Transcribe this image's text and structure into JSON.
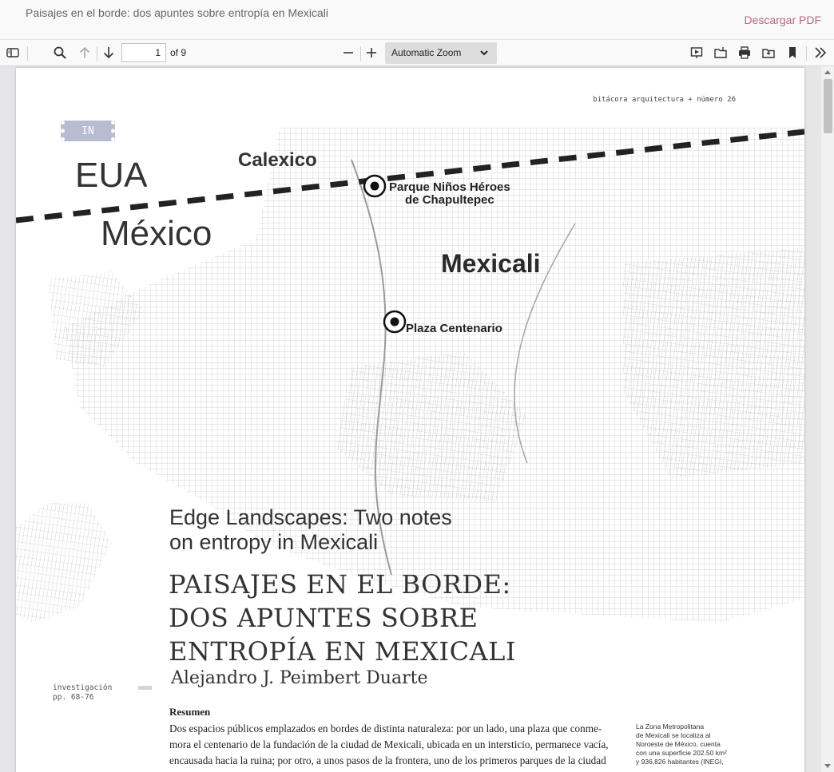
{
  "header": {
    "title": "Paisajes en el borde: dos apuntes sobre entropía en Mexicali",
    "download_label": "Descargar PDF"
  },
  "toolbar": {
    "page_number": "1",
    "page_count_label": "of 9",
    "zoom_label": "Automatic Zoom"
  },
  "document": {
    "journal_line": "bitácora arquitectura + número 26",
    "section_tag": "IN",
    "map": {
      "label_eua": "EUA",
      "label_mexico": "México",
      "label_calexico": "Calexico",
      "label_mexicali": "Mexicali",
      "label_parque": [
        "Parque Niños Héroes",
        "de Chapultepec"
      ],
      "label_plaza": "Plaza Centenario"
    },
    "english_title": [
      "Edge Landscapes: Two notes",
      "on entropy in Mexicali"
    ],
    "spanish_title": [
      "PAISAJES EN EL BORDE:",
      "DOS APUNTES SOBRE",
      "ENTROPÍA EN MEXICALI"
    ],
    "author": "Alejandro J. Peimbert Duarte",
    "category": [
      "investigación",
      "pp. 68-76"
    ],
    "abstract_heading": "Resumen",
    "abstract_lines": [
      "Dos espacios públicos emplazados en bordes de distinta naturaleza: por un lado, una plaza que conme-",
      "mora el centenario de la fundación de la ciudad de Mexicali, ubicada en un intersticio, permanece vacía,",
      "encausada hacia la ruina; por otro, a unos pasos de la frontera, uno de los primeros parques de la ciudad"
    ],
    "sidenote_lines": [
      "La Zona Metropolitana",
      "de Mexicali se localiza al",
      "Noroeste de México, cuenta",
      "con una superficie 202.50 km²",
      "y 936,826 habitantes (INEGI,"
    ]
  }
}
